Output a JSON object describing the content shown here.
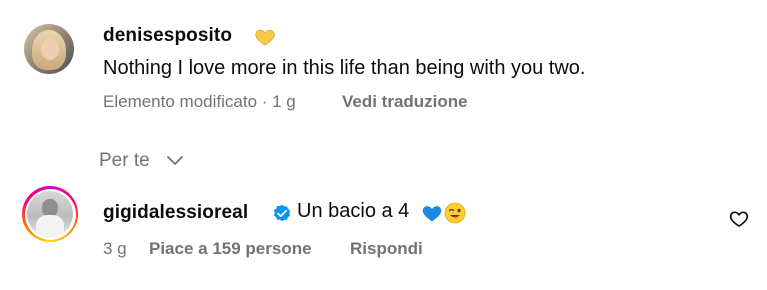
{
  "comments": [
    {
      "username": "denisesposito",
      "badge_icon": "yellow-heart-icon",
      "text": "Nothing I love more in this life than being with you two.",
      "edited_label": "Elemento modificato · 1 g",
      "translate_label": "Vedi traduzione"
    },
    {
      "username": "gigidalessioreal",
      "verified_icon": "verified-badge-icon",
      "text": "Un bacio a 4",
      "emojis": [
        "blue-heart-icon",
        "winking-face-with-tongue-icon"
      ],
      "time": "3 g",
      "likes": "Piace a 159 persone",
      "reply_label": "Rispondi",
      "like_icon": "heart-outline-icon"
    }
  ],
  "sort": {
    "label": "Per te",
    "icon": "chevron-down-icon"
  },
  "colors": {
    "text": "#0c0c0c",
    "meta": "#737373",
    "verified": "#0095f6",
    "heart_yellow": "#f7c948",
    "heart_blue": "#1e88e5"
  }
}
